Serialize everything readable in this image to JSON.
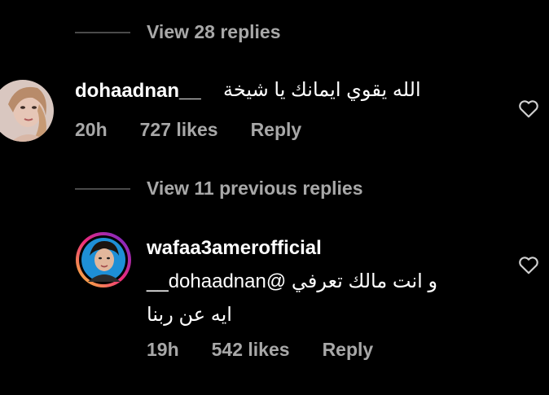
{
  "thread1": {
    "view_replies": "View 28 replies"
  },
  "comment1": {
    "username": "dohaadnan__",
    "text": "الله يقوي ايمانك يا شيخة",
    "time": "20h",
    "likes": "727 likes",
    "reply": "Reply"
  },
  "thread2": {
    "view_previous": "View 11 previous replies"
  },
  "comment2": {
    "username": "wafaa3amerofficial",
    "line1": "و انت مالك تعرفي @dohaadnan__",
    "line2": "ايه عن ربنا",
    "time": "19h",
    "likes": "542 likes",
    "reply": "Reply"
  },
  "icons": {
    "like": "heart-outline-icon",
    "avatar1": "user-avatar",
    "avatar2": "verified-story-avatar"
  },
  "colors": {
    "background": "#000000",
    "muted_text": "#a8a8a8",
    "divider": "#4a4a4a",
    "story_ring_start": "#f9ce34",
    "story_ring_mid": "#ee2a7b",
    "story_ring_end": "#6228d7"
  }
}
